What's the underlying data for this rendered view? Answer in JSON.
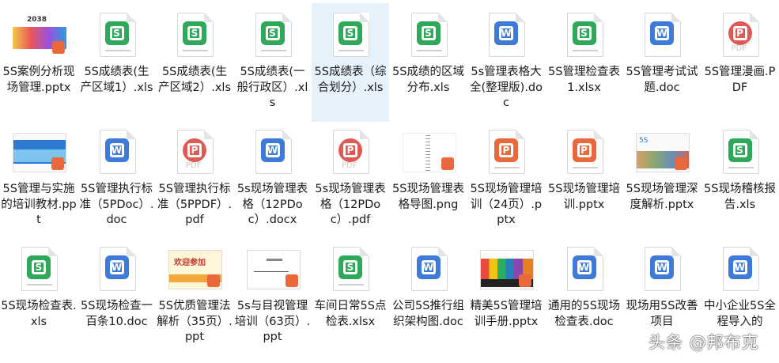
{
  "files": [
    {
      "name": "5S案例分析现场管理.pptx",
      "icon": "thumb-pptx",
      "thumb": "2038"
    },
    {
      "name": "5S成绩表(生产区域1）.xls",
      "icon": "excel"
    },
    {
      "name": "5S成绩表(生产区域2）.xls",
      "icon": "excel"
    },
    {
      "name": "5S成绩表(一般行政区）.xls",
      "icon": "excel"
    },
    {
      "name": "5S成绩表（综合划分）.xls",
      "icon": "excel",
      "selected": true
    },
    {
      "name": "5S成绩的区域分布.xls",
      "icon": "excel"
    },
    {
      "name": "5s管理表格大全(整理版).doc",
      "icon": "word"
    },
    {
      "name": "5S管理检查表1.xlsx",
      "icon": "excel"
    },
    {
      "name": "5S管理考试试题.doc",
      "icon": "word"
    },
    {
      "name": "5S管理漫画.PDF",
      "icon": "pdf"
    },
    {
      "name": "5S管理与实施的培训教材.ppt",
      "icon": "thumb-ppt"
    },
    {
      "name": "5S管理执行标准（5PDoc）.doc",
      "icon": "word"
    },
    {
      "name": "5S管理执行标准（5PPDF）.pdf",
      "icon": "pdf"
    },
    {
      "name": "5s现场管理表格（12PDoc）.docx",
      "icon": "word"
    },
    {
      "name": "5s现场管理表格（12PDoc）.pdf",
      "icon": "pdf"
    },
    {
      "name": "5S现场管理表格导图.png",
      "icon": "thumb-png"
    },
    {
      "name": "5S现场管理培训（24页）.pptx",
      "icon": "ppt"
    },
    {
      "name": "5S现场管理培训.pptx",
      "icon": "ppt"
    },
    {
      "name": "5S现场管理深度解析.pptx",
      "icon": "thumb-pptx2",
      "thumb": "5S"
    },
    {
      "name": "5S现场稽核报告.xls",
      "icon": "excel"
    },
    {
      "name": "5S现场检查表.xls",
      "icon": "excel"
    },
    {
      "name": "5S现场检查一百条10.doc",
      "icon": "word"
    },
    {
      "name": "5S优质管理法解析（35页）.ppt",
      "icon": "thumb-ppt2",
      "thumb": "欢迎参加"
    },
    {
      "name": "5s与目视管理培训（63页）.ppt",
      "icon": "thumb-ppt3"
    },
    {
      "name": "车间日常5S点检表.xlsx",
      "icon": "excel"
    },
    {
      "name": "公司5S推行组织架构图.doc",
      "icon": "word"
    },
    {
      "name": "精美5S管理培训手册.pptx",
      "icon": "thumb-pptx3"
    },
    {
      "name": "通用的5S现场检查表.doc",
      "icon": "word"
    },
    {
      "name": "现场用5S改善项目",
      "icon": "word"
    },
    {
      "name": "中小企业5S全程导入的",
      "icon": "word"
    }
  ],
  "watermark": "头条 @邦布克",
  "colors": {
    "excel": "#2fa85a",
    "word": "#3e7ad8",
    "ppt": "#e9693c",
    "pdf": "#e05a55",
    "selected": "#e5f1fb"
  }
}
